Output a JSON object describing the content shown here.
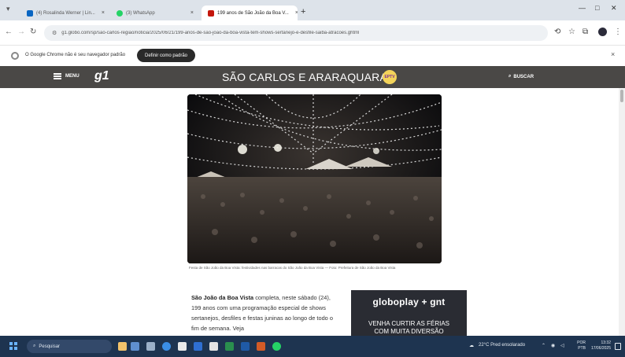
{
  "browser": {
    "tabs": [
      {
        "label": "(4) Rosalinda Werner | Lin...",
        "active": false
      },
      {
        "label": "(3) WhatsApp",
        "active": false
      },
      {
        "label": "199 anos de São João da Boa V...",
        "active": true
      }
    ],
    "url": "g1.globo.com/sp/sao-carlos-regiao/noticia/2025/06/21/199-anos-de-sao-joao-da-boa-vista-tem-shows-sertanejo-e-desfile-saiba-atracoes.ghtml",
    "infobar": {
      "message": "O Google Chrome não é seu navegador padrão",
      "button_label": "Definir como padrão"
    }
  },
  "site": {
    "menu_label": "MENU",
    "logo": "g1",
    "region_title": "SÃO CARLOS E ARARAQUARA",
    "badge_text": "EPTV",
    "search_label": "BUSCAR"
  },
  "article": {
    "photo_caption": "Festa de São João da Boa Vista: festividades nas barracas do São João da Boa Vista — Foto: Prefeitura de São João da Boa Vista",
    "lead_strong": "São João da Boa Vista",
    "lead_text": " completa, neste sábado (24), 199 anos com uma programação especial de shows sertanejos, desfiles e festas juninas ao longo de todo o fim de semana. Veja"
  },
  "ad": {
    "brand": "globoplay + gnt",
    "line1": "VENHA CURTIR AS FÉRIAS",
    "line2": "COM MUITA DIVERSÃO"
  },
  "taskbar": {
    "search_placeholder": "Pesquisar",
    "weather": "22°C  Pred ensolarado",
    "lang_top": "POR",
    "lang_bottom": "PTB",
    "time": "13:32",
    "date": "17/06/2025"
  },
  "colors": {
    "site_header": "#4a4846",
    "taskbar": "#1e3450",
    "ad_bg": "#2a2c33"
  }
}
